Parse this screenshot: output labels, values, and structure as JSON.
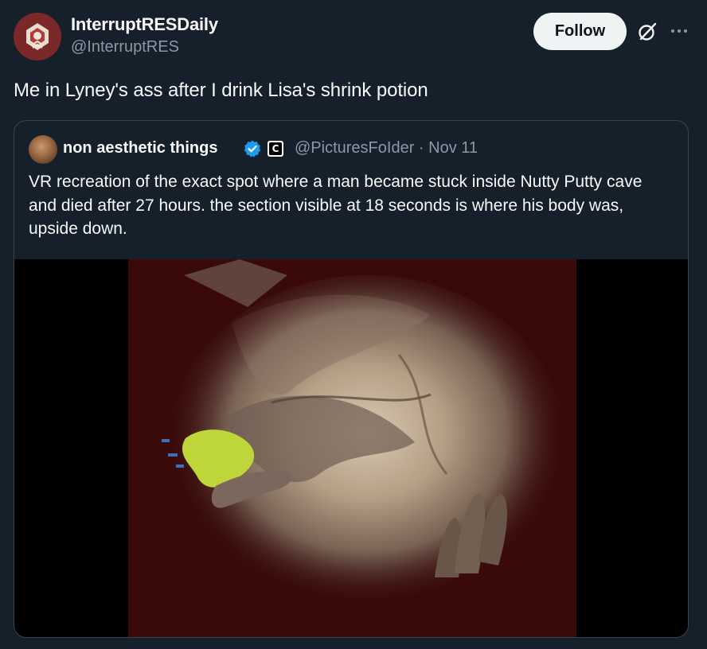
{
  "tweet": {
    "author": {
      "name": "InterruptRESDaily",
      "handle": "@InterruptRES"
    },
    "follow_label": "Follow",
    "text": "Me in Lyney's ass after I drink Lisa's shrink potion",
    "icons": {
      "grok": "grok-icon",
      "more": "more-icon"
    }
  },
  "quote": {
    "author": {
      "name": "non aesthetic things",
      "handle_date": "@PicturesFoIder · Nov 11",
      "affiliate_badge": "C"
    },
    "text": "VR recreation of the exact spot where a man became stuck inside Nutty Putty cave and died after 27 hours. the section visible at 18 seconds is where his body was, upside down.",
    "media": {
      "type": "video"
    }
  },
  "colors": {
    "background": "#15202b",
    "text": "#f7f9f9",
    "secondary_text": "#8b98a5",
    "border": "#38444d",
    "verified": "#1d9bf0",
    "follow_bg": "#eff3f4"
  }
}
